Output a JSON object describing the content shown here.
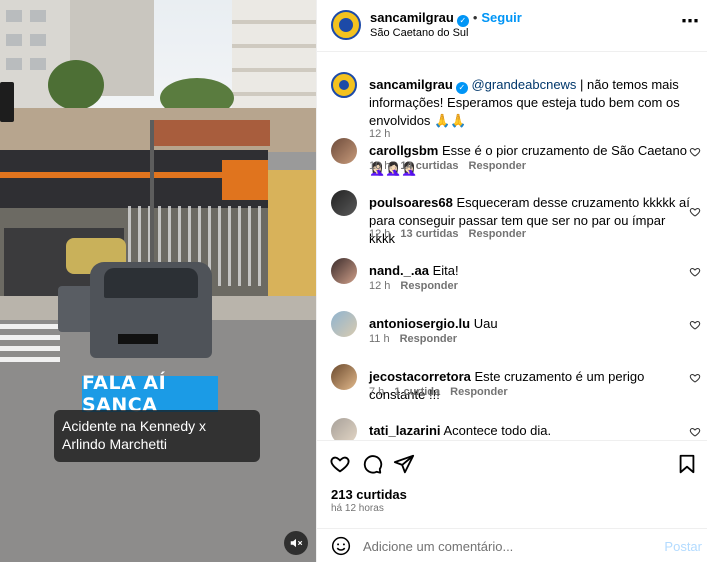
{
  "media": {
    "badge_text": "FALA AÍ SANCA",
    "caption": "Acidente na Kennedy x Arlindo Marchetti",
    "mute_icon": "volume-muted-icon"
  },
  "header": {
    "username": "sancamilgrau",
    "follow_label": "Seguir",
    "location": "São Caetano do Sul",
    "more_icon": "more-horizontal-icon"
  },
  "post_caption": {
    "username": "sancamilgrau",
    "mention": "@grandeabcnews",
    "text": " | não temos mais informações! Esperamos que esteja tudo bem com os envolvidos 🙏🙏",
    "time": "12 h"
  },
  "comments": [
    {
      "user": "carollgsbm",
      "text": "Esse é o pior cruzamento de São Caetano 🤦🏻‍♀️🤦🏻‍♀️🤦🏻‍♀️",
      "time": "10 h",
      "likes": "14 curtidas",
      "reply": "Responder"
    },
    {
      "user": "poulsoares68",
      "text": "Esqueceram desse cruzamento kkkkk aí para conseguir passar tem que ser no par ou ímpar kkkk",
      "time": "12 h",
      "likes": "13 curtidas",
      "reply": "Responder"
    },
    {
      "user": "nand._.aa",
      "text": "Eita!",
      "time": "12 h",
      "likes": "",
      "reply": "Responder"
    },
    {
      "user": "antoniosergio.lu",
      "text": "Uau",
      "time": "11 h",
      "likes": "",
      "reply": "Responder"
    },
    {
      "user": "jecostacorretora",
      "text": "Este cruzamento é um perigo constante !!!",
      "time": "7 h",
      "likes": "1 curtida",
      "reply": "Responder"
    },
    {
      "user": "tati_lazarini",
      "text": "Acontece todo dia.",
      "time": "",
      "likes": "",
      "reply": ""
    }
  ],
  "actions": {
    "like_icon": "heart-icon",
    "comment_icon": "comment-icon",
    "share_icon": "send-icon",
    "save_icon": "bookmark-icon",
    "likes_count": "213 curtidas",
    "time_ago": "há 12 horas"
  },
  "composer": {
    "placeholder": "Adicione um comentário...",
    "post_label": "Postar",
    "emoji_icon": "emoji-icon"
  }
}
